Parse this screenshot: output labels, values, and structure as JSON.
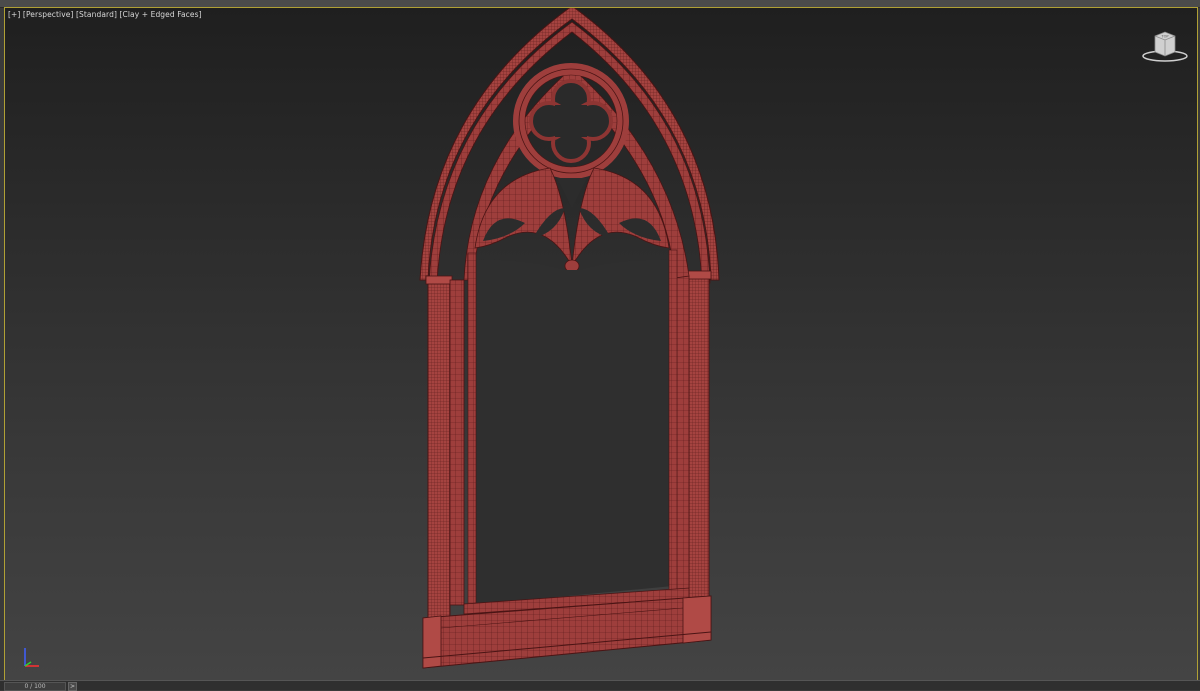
{
  "viewport": {
    "label_plus": "[+]",
    "label_view": "[Perspective]",
    "label_shading": "[Standard]",
    "label_render": "[Clay + Edged Faces]",
    "viewcube_face": "TOP"
  },
  "timeline": {
    "frame": "0 / 100",
    "next_icon": ">"
  },
  "colors": {
    "model_fill": "#9e3e3c",
    "model_edge": "#5a1a1a",
    "viewport_border": "#b0a035"
  },
  "icons": [
    "viewcube-icon",
    "axis-tripod-icon"
  ]
}
